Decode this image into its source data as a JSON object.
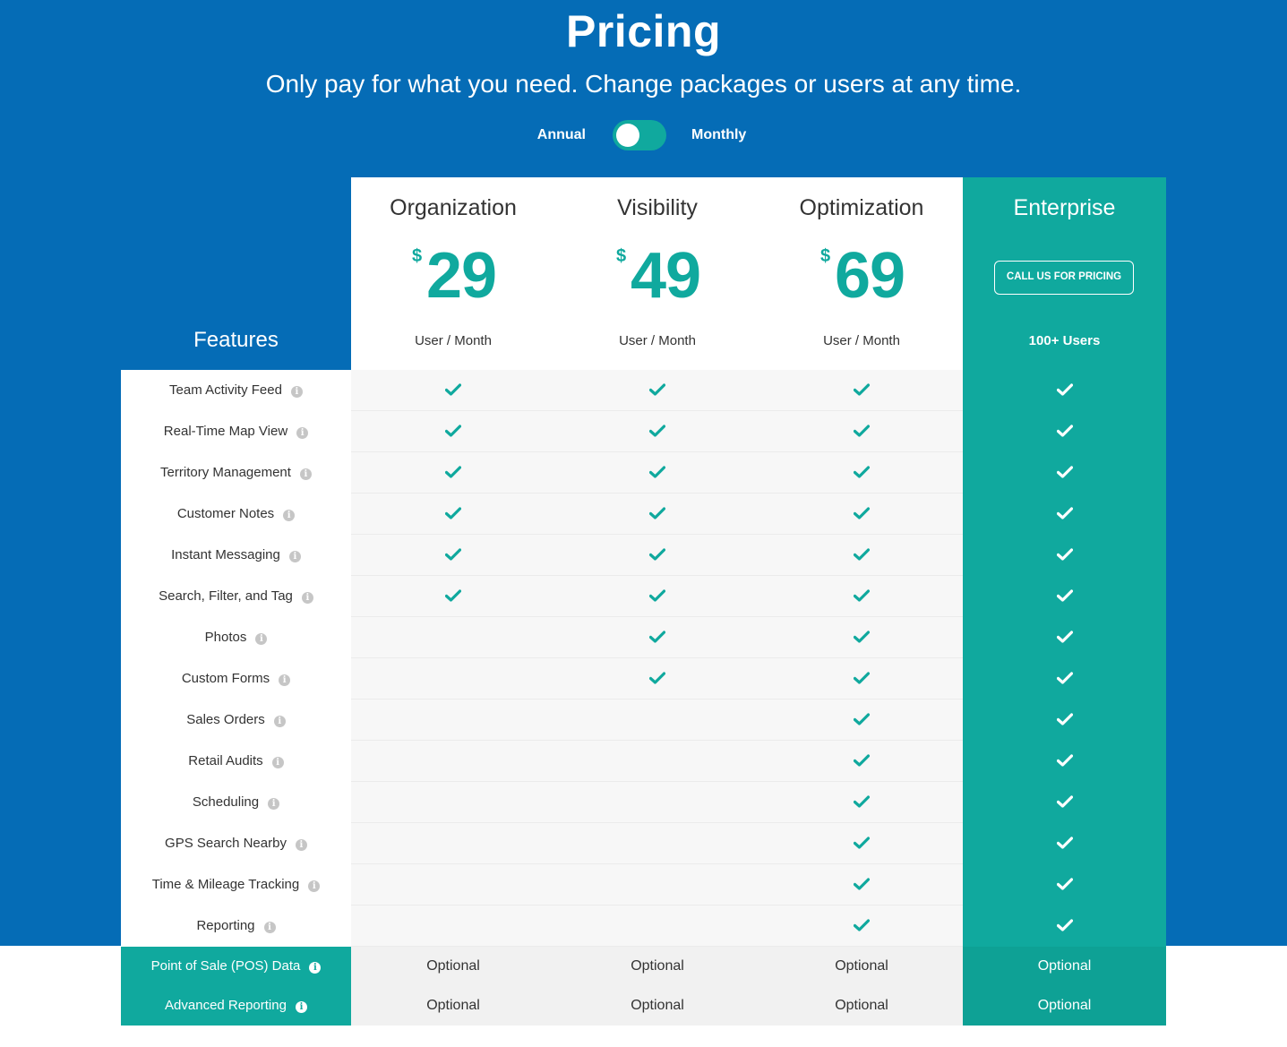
{
  "header": {
    "title": "Pricing",
    "subtitle": "Only pay for what you need. Change packages or users at any time.",
    "toggle": {
      "left_label": "Annual",
      "right_label": "Monthly",
      "selected": "Annual"
    }
  },
  "colors": {
    "brand_blue": "#056cb6",
    "accent_teal": "#10a99e"
  },
  "features_title": "Features",
  "plans": [
    {
      "name": "Organization",
      "currency": "$",
      "price": "29",
      "period": "User / Month"
    },
    {
      "name": "Visibility",
      "currency": "$",
      "price": "49",
      "period": "User / Month"
    },
    {
      "name": "Optimization",
      "currency": "$",
      "price": "69",
      "period": "User / Month"
    },
    {
      "name": "Enterprise",
      "cta": "CALL US FOR PRICING",
      "period": "100+ Users"
    }
  ],
  "features": [
    {
      "name": "Team Activity Feed",
      "included": [
        true,
        true,
        true,
        true
      ]
    },
    {
      "name": "Real-Time Map View",
      "included": [
        true,
        true,
        true,
        true
      ]
    },
    {
      "name": "Territory Management",
      "included": [
        true,
        true,
        true,
        true
      ]
    },
    {
      "name": "Customer Notes",
      "included": [
        true,
        true,
        true,
        true
      ]
    },
    {
      "name": "Instant Messaging",
      "included": [
        true,
        true,
        true,
        true
      ]
    },
    {
      "name": "Search, Filter, and Tag",
      "included": [
        true,
        true,
        true,
        true
      ]
    },
    {
      "name": "Photos",
      "included": [
        false,
        true,
        true,
        true
      ]
    },
    {
      "name": "Custom Forms",
      "included": [
        false,
        true,
        true,
        true
      ]
    },
    {
      "name": "Sales Orders",
      "included": [
        false,
        false,
        true,
        true
      ]
    },
    {
      "name": "Retail Audits",
      "included": [
        false,
        false,
        true,
        true
      ]
    },
    {
      "name": "Scheduling",
      "included": [
        false,
        false,
        true,
        true
      ]
    },
    {
      "name": "GPS Search Nearby",
      "included": [
        false,
        false,
        true,
        true
      ]
    },
    {
      "name": "Time & Mileage Tracking",
      "included": [
        false,
        false,
        true,
        true
      ]
    },
    {
      "name": "Reporting",
      "included": [
        false,
        false,
        true,
        true
      ]
    }
  ],
  "optional_features": [
    {
      "name": "Point of Sale (POS) Data",
      "values": [
        "Optional",
        "Optional",
        "Optional",
        "Optional"
      ]
    },
    {
      "name": "Advanced Reporting",
      "values": [
        "Optional",
        "Optional",
        "Optional",
        "Optional"
      ]
    }
  ],
  "icons": {
    "info": "info-circle-icon",
    "check": "checkmark-icon"
  }
}
